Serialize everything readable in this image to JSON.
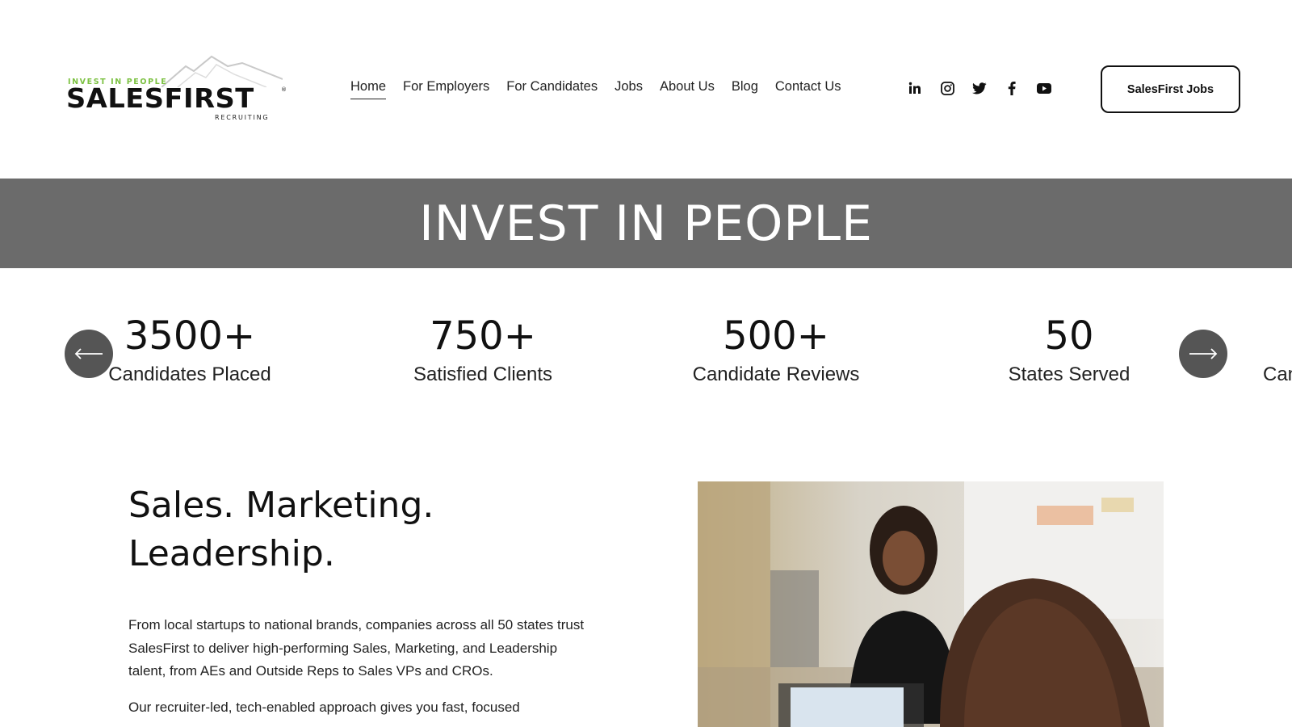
{
  "header": {
    "logo": {
      "tagline": "INVEST IN PEOPLE",
      "wordmark": "SALESFIRST",
      "registered": "®",
      "subtitle": "RECRUITING"
    },
    "nav": [
      {
        "label": "Home",
        "active": true
      },
      {
        "label": "For Employers",
        "active": false
      },
      {
        "label": "For Candidates",
        "active": false
      },
      {
        "label": "Jobs",
        "active": false
      },
      {
        "label": "About Us",
        "active": false
      },
      {
        "label": "Blog",
        "active": false
      },
      {
        "label": "Contact Us",
        "active": false
      }
    ],
    "social": [
      "linkedin-icon",
      "instagram-icon",
      "twitter-icon",
      "facebook-icon",
      "youtube-icon"
    ],
    "cta_label": "SalesFirst Jobs"
  },
  "banner": {
    "title": "INVEST IN PEOPLE",
    "background": "#6b6b6b"
  },
  "stats": [
    {
      "value": "3500+",
      "label": "Candidates Placed"
    },
    {
      "value": "750+",
      "label": "Satisfied Clients"
    },
    {
      "value": "500+",
      "label": "Candidate Reviews"
    },
    {
      "value": "50",
      "label": "States Served"
    },
    {
      "value": "",
      "label": "Can"
    }
  ],
  "main": {
    "headline_line1": "Sales. Marketing.",
    "headline_line2": "Leadership.",
    "paragraph1": "From local startups to national brands, companies across all 50 states trust SalesFirst to deliver high-performing Sales, Marketing, and Leadership talent, from AEs and Outside Reps to Sales VPs and CROs.",
    "paragraph2": "Our recruiter-led, tech-enabled approach gives you fast, focused"
  },
  "colors": {
    "accent_green": "#7cc142",
    "text": "#111111",
    "arrow_bg": "#555555"
  }
}
